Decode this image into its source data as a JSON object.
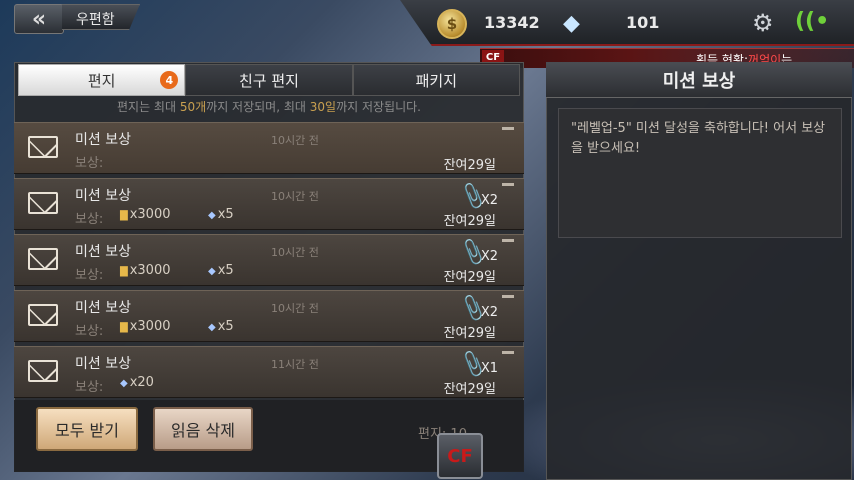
{
  "header": {
    "title": "우편함",
    "coins": "13342",
    "gems": "101",
    "ticker_prefix": "획득 현황:",
    "ticker_name": "꺼억이",
    "ticker_suffix": "는"
  },
  "tabs": [
    {
      "label": "편지",
      "badge": "4"
    },
    {
      "label": "친구 편지"
    },
    {
      "label": "패키지"
    }
  ],
  "notice": {
    "part1": "편지는 최대 ",
    "num1": "50개",
    "part2": "까지 저장되며, 최대 ",
    "num2": "30일",
    "part3": "까지 저장됩니다."
  },
  "mails": [
    {
      "title": "미션 보상",
      "time": "10시간 전",
      "reward_label": "보상:",
      "gold": "",
      "gem": "",
      "attach": "",
      "expire": "잔여29일"
    },
    {
      "title": "미션 보상",
      "time": "10시간 전",
      "reward_label": "보상:",
      "gold": "x3000",
      "gem": "x5",
      "attach": "X2",
      "expire": "잔여29일"
    },
    {
      "title": "미션 보상",
      "time": "10시간 전",
      "reward_label": "보상:",
      "gold": "x3000",
      "gem": "x5",
      "attach": "X2",
      "expire": "잔여29일"
    },
    {
      "title": "미션 보상",
      "time": "10시간 전",
      "reward_label": "보상:",
      "gold": "x3000",
      "gem": "x5",
      "attach": "X2",
      "expire": "잔여29일"
    },
    {
      "title": "미션 보상",
      "time": "11시간 전",
      "reward_label": "보상:",
      "gold": "",
      "gem": "x20",
      "attach": "X1",
      "expire": "잔여29일"
    }
  ],
  "footer": {
    "receive_all": "모두 받기",
    "delete_read": "읽음 삭제",
    "mail_count": "편지: 10"
  },
  "detail": {
    "title": "미션 보상",
    "message": "\"레벨업-5\" 미션 달성을 축하합니다! 어서 보상을 받으세요!"
  },
  "colors": {
    "accent_red": "#c81a1a",
    "badge_orange": "#e86a1a",
    "highlight_gold": "#c9a050"
  }
}
